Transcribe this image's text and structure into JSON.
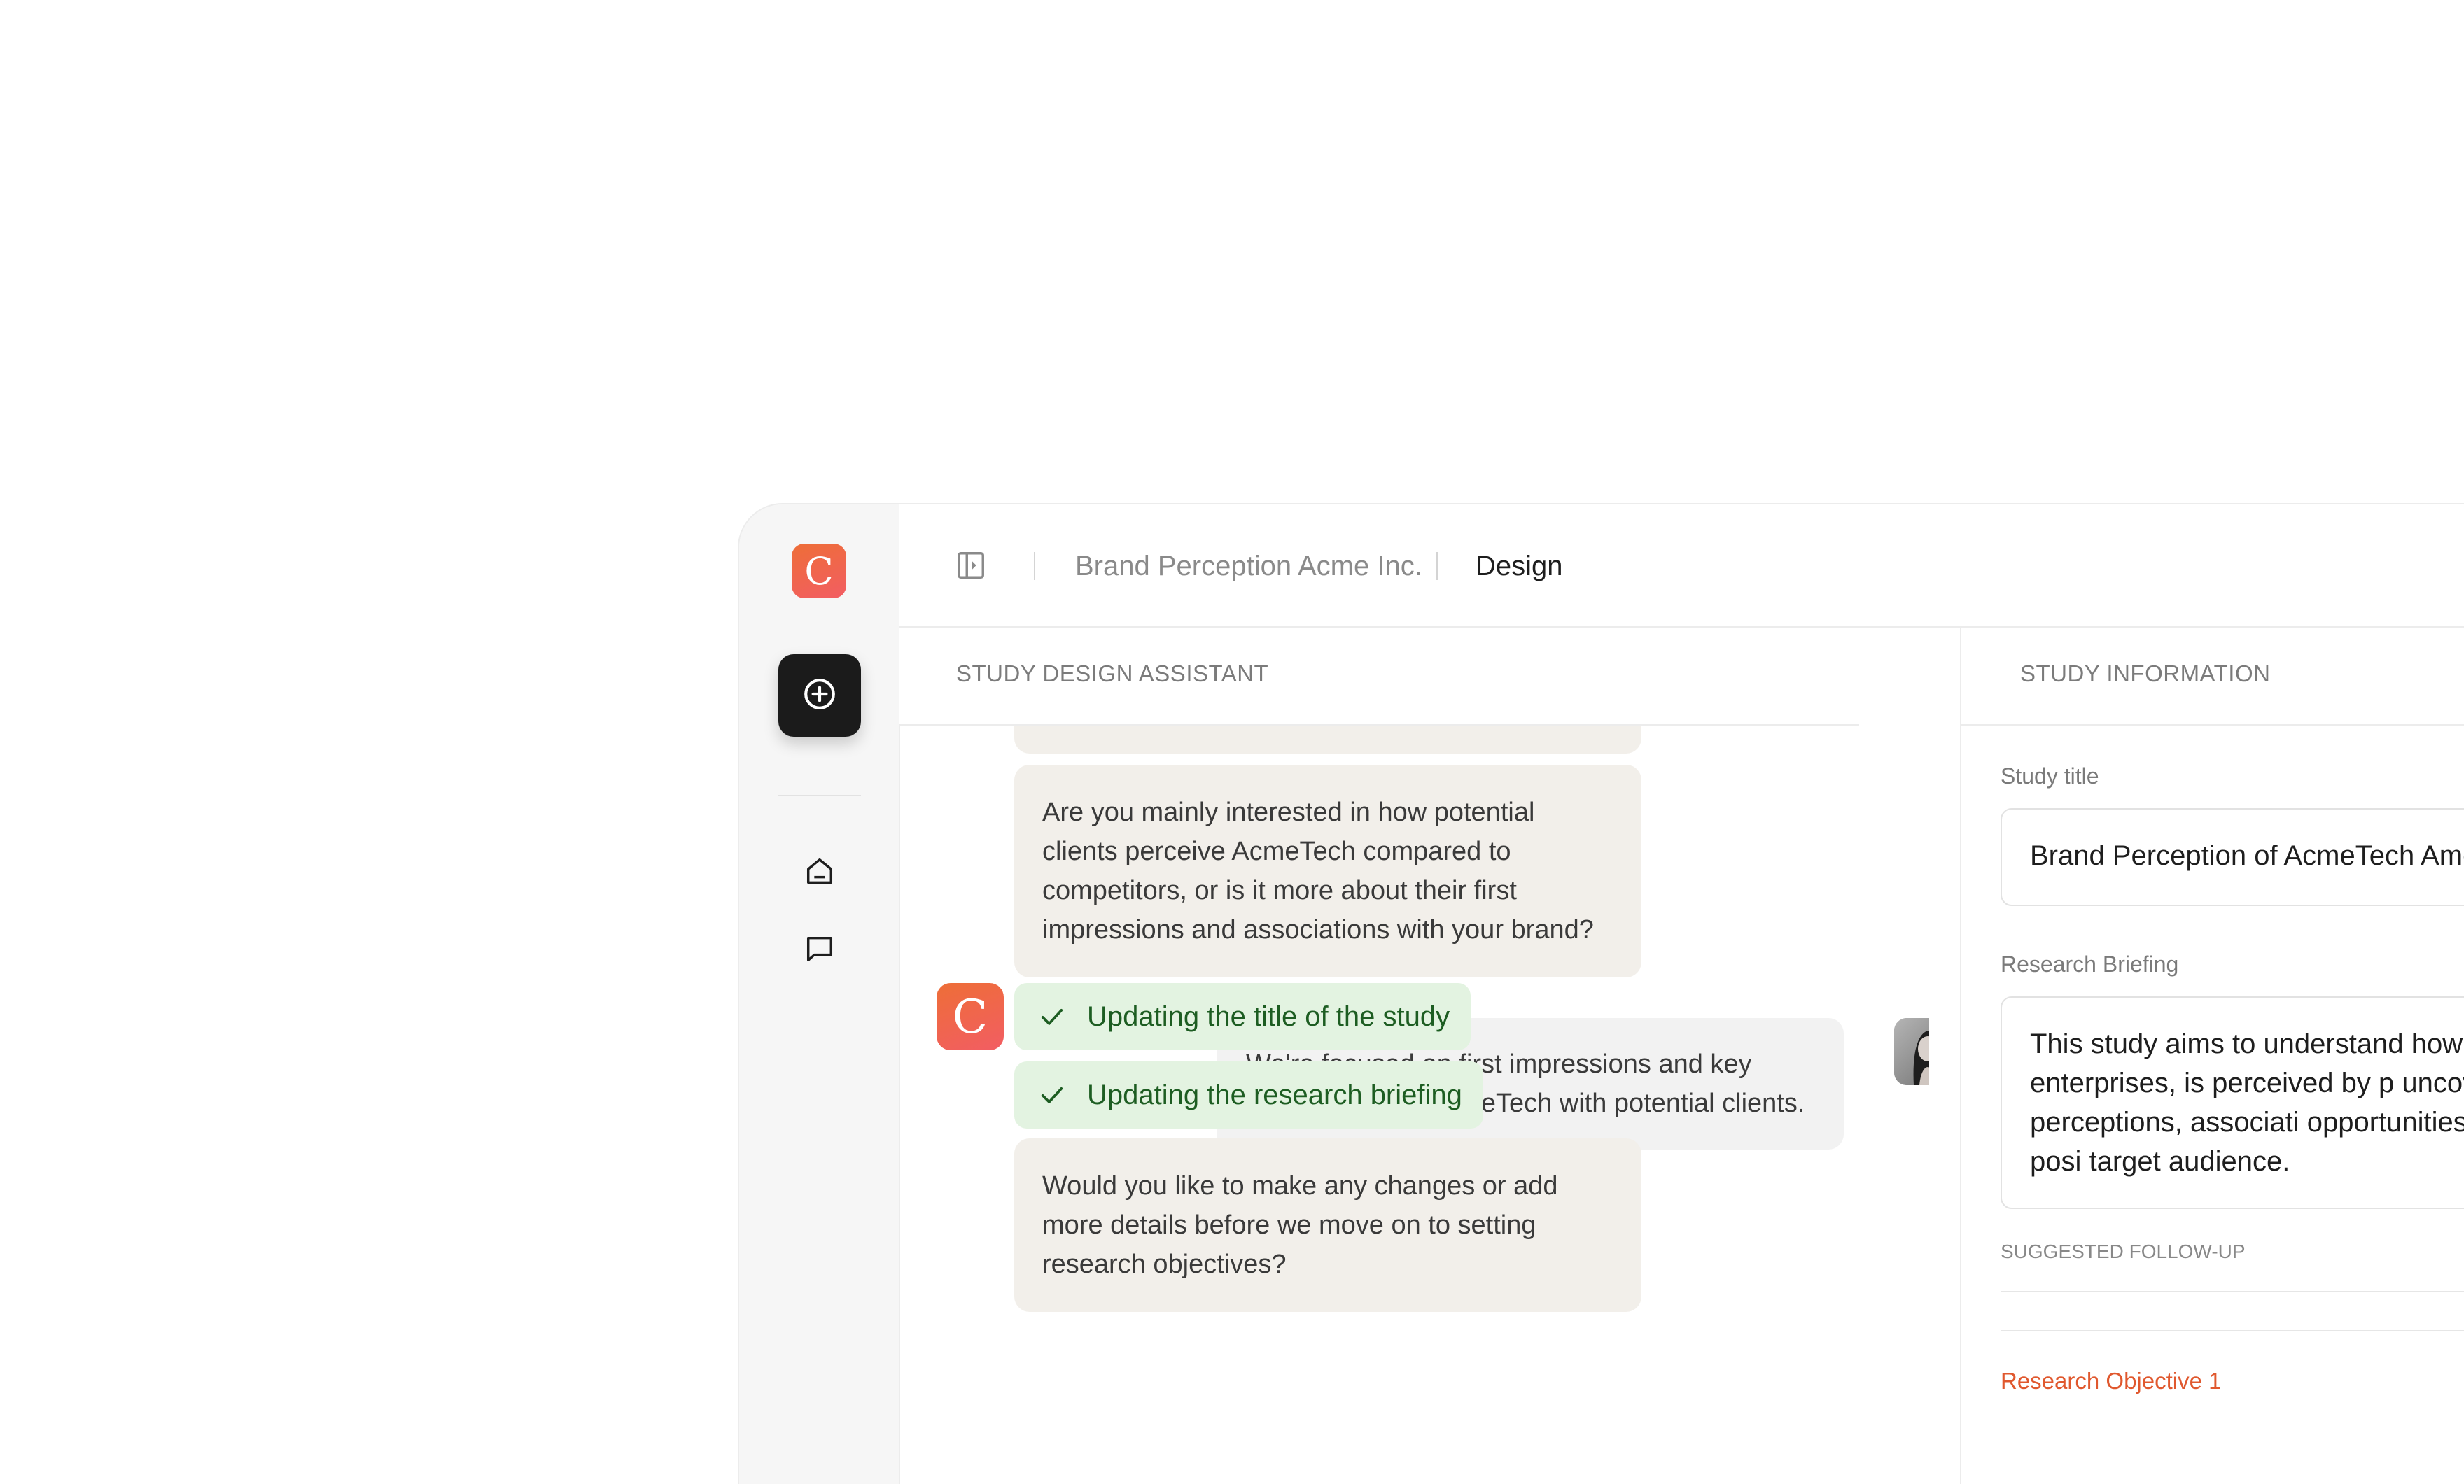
{
  "brand": {
    "logo_letter": "C",
    "accent": "#ee6e37",
    "accent_secondary": "#f25d63"
  },
  "rail": {
    "new_button_icon": "plus-circle-icon",
    "items": [
      {
        "icon": "home-icon"
      },
      {
        "icon": "chat-icon"
      }
    ]
  },
  "topbar": {
    "toggle_icon": "sidebar-toggle-icon",
    "project": "Brand Perception Acme Inc.",
    "current": "Design"
  },
  "assistant": {
    "section_label": "STUDY DESIGN ASSISTANT",
    "messages": [
      {
        "role": "assistant",
        "text": "Are you mainly interested in how potential clients perceive AcmeTech compared to competitors, or is it more about their first impressions and associations with your brand?"
      },
      {
        "role": "user",
        "text": "We're focused on first impressions and key associations of AcmeTech with potential clients."
      },
      {
        "role": "status",
        "text": "Updating the title of the study",
        "icon": "check-icon"
      },
      {
        "role": "status",
        "text": "Updating the research briefing",
        "icon": "check-icon"
      },
      {
        "role": "assistant",
        "text": "Would you like to make any changes or add more details before we move on to setting research objectives?"
      }
    ],
    "status_color": "#1d5d22",
    "status_bg": "#e3f3e1"
  },
  "info": {
    "section_label": "STUDY INFORMATION",
    "title_label": "Study title",
    "title_value": "Brand Perception of AcmeTech Among",
    "briefing_label": "Research Briefing",
    "briefing_value": "This study aims to understand how Ac mid-size enterprises, is perceived by p uncover current perceptions, associati opportunities for improving brand posi target audience.",
    "followup_label": "SUGGESTED FOLLOW-UP",
    "objective_link": "Research Objective 1",
    "link_color": "#e0582e"
  }
}
